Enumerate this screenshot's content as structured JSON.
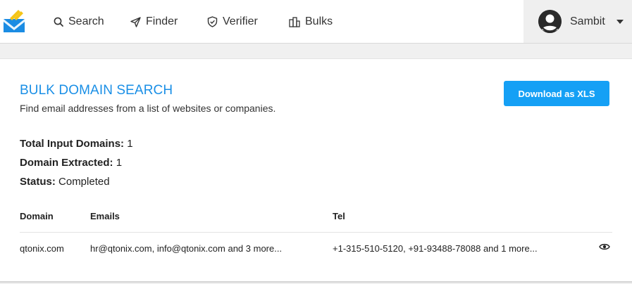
{
  "nav": {
    "items": [
      {
        "label": "Search",
        "icon": "search-icon"
      },
      {
        "label": "Finder",
        "icon": "send-icon"
      },
      {
        "label": "Verifier",
        "icon": "shield-check-icon"
      },
      {
        "label": "Bulks",
        "icon": "buildings-icon"
      }
    ]
  },
  "user": {
    "name": "Sambit"
  },
  "page": {
    "title": "BULK DOMAIN SEARCH",
    "subtitle": "Find email addresses from a list of websites or companies.",
    "download_label": "Download as XLS"
  },
  "stats": {
    "total_input": {
      "label": "Total Input Domains:",
      "value": "1"
    },
    "extracted": {
      "label": "Domain Extracted:",
      "value": "1"
    },
    "status": {
      "label": "Status:",
      "value": "Completed"
    }
  },
  "table": {
    "headers": {
      "domain": "Domain",
      "emails": "Emails",
      "tel": "Tel"
    },
    "rows": [
      {
        "domain": "qtonix.com",
        "emails": "hr@qtonix.com, info@qtonix.com and 3 more...",
        "tel": "+1-315-510-5120, +91-93488-78088 and 1 more..."
      }
    ]
  },
  "colors": {
    "accent": "#1a8fe6",
    "button": "#15a0f5",
    "logo_blue": "#1b8ce3",
    "logo_yellow": "#f5c518"
  }
}
